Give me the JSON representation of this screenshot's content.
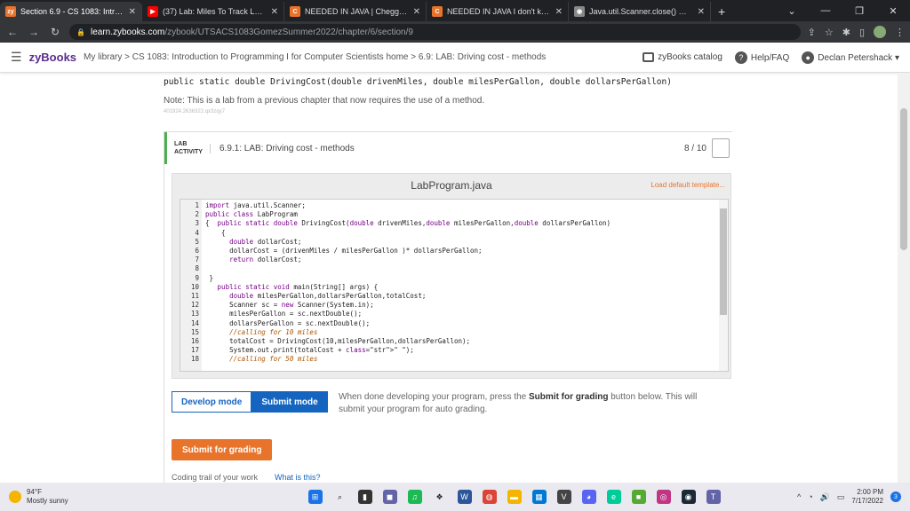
{
  "browser": {
    "tabs": [
      {
        "title": "Section 6.9 - CS 1083: Introductio",
        "favicon": "zy",
        "color": "#e8742c",
        "active": true
      },
      {
        "title": "(37) Lab: Miles To Track Laps - Yo",
        "favicon": "▶",
        "color": "#ff0000",
        "active": false
      },
      {
        "title": "NEEDED IN JAVA | Chegg.com",
        "favicon": "C",
        "color": "#e8742c",
        "active": false
      },
      {
        "title": "NEEDED IN JAVA I don't know wh",
        "favicon": "C",
        "color": "#e8742c",
        "active": false
      },
      {
        "title": "Java.util.Scanner.close() Method",
        "favicon": "◉",
        "color": "#888888",
        "active": false
      }
    ],
    "new_tab": "+",
    "url_host": "learn.zybooks.com",
    "url_path": "/zybook/UTSACS1083GomezSummer2022/chapter/6/section/9"
  },
  "header": {
    "logo": "zyBooks",
    "crumbs": "My library > CS 1083: Introduction to Programming I for Computer Scientists home > 6.9: LAB: Driving cost - methods",
    "catalog": "zyBooks catalog",
    "help": "Help/FAQ",
    "user": "Declan Petershack"
  },
  "content": {
    "signature": "public static double DrivingCost(double drivenMiles, double milesPerGallon, double dollarsPerGallon)",
    "note": "Note: This is a lab from a previous chapter that now requires the use of a method.",
    "tiny": "401924.2636322.qx3zqy7"
  },
  "lab": {
    "label_line1": "LAB",
    "label_line2": "ACTIVITY",
    "title": "6.9.1: LAB: Driving cost - methods",
    "score": "8 / 10",
    "filename": "LabProgram.java",
    "load_default": "Load default template...",
    "line_numbers": "1\n2\n3\n4\n5\n6\n7\n8\n9\n10\n11\n12\n13\n14\n15\n16\n17\n18",
    "code": "import java.util.Scanner;\npublic class LabProgram\n{  public static double DrivingCost(double drivenMiles,double milesPerGallon,double dollarsPerGallon)\n    {\n      double dollarCost;\n      dollarCost = (drivenMiles / milesPerGallon )* dollarsPerGallon;\n      return dollarCost;\n\n }\n   public static void main(String[] args) {\n      double milesPerGallon,dollarsPerGallon,totalCost;\n      Scanner sc = new Scanner(System.in);\n      milesPerGallon = sc.nextDouble();\n      dollarsPerGallon = sc.nextDouble();\n      //calling for 10 miles\n      totalCost = DrivingCost(10,milesPerGallon,dollarsPerGallon);\n      System.out.print(totalCost + \" \");\n      //calling for 50 miles",
    "develop_mode": "Develop mode",
    "submit_mode": "Submit mode",
    "mode_help_pre": "When done developing your program, press the ",
    "mode_help_bold": "Submit for grading",
    "mode_help_post": " button below. This will submit your program for auto grading.",
    "submit_button": "Submit for grading",
    "trail": "Coding trail of your work",
    "whatis": "What is this?"
  },
  "taskbar": {
    "temp": "94°F",
    "weather": "Mostly sunny",
    "time": "2:00 PM",
    "date": "7/17/2022",
    "notif_count": "3"
  }
}
